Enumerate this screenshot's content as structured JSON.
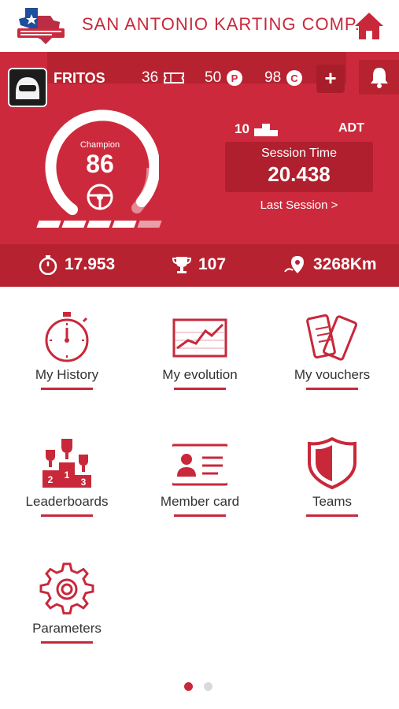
{
  "app": {
    "title": "SAN ANTONIO KARTING COMP..."
  },
  "colors": {
    "brand_red": "#cc2a3c",
    "dark_red": "#b6222f",
    "text": "#333333"
  },
  "user": {
    "name": "FRITOS",
    "tickets": "36",
    "points": "50",
    "credits": "98",
    "add_label": "+"
  },
  "gauge": {
    "level_label": "Champion",
    "value": "86",
    "progress_fraction": 0.8,
    "segments_filled": 4,
    "segments_total": 5
  },
  "rank": {
    "position": "10",
    "code": "ADT"
  },
  "session": {
    "label": "Session Time",
    "value": "20.438",
    "link": "Last Session >"
  },
  "stats": {
    "best_time": "17.953",
    "trophies": "107",
    "distance": "3268Km"
  },
  "menu": [
    {
      "label": "My History",
      "icon": "stopwatch-icon"
    },
    {
      "label": "My evolution",
      "icon": "chart-icon"
    },
    {
      "label": "My vouchers",
      "icon": "tickets-icon"
    },
    {
      "label": "Leaderboards",
      "icon": "podium-icon"
    },
    {
      "label": "Member card",
      "icon": "id-card-icon"
    },
    {
      "label": "Teams",
      "icon": "shield-icon"
    },
    {
      "label": "Parameters",
      "icon": "gear-icon"
    }
  ],
  "pager": {
    "pages": 2,
    "active": 1
  }
}
